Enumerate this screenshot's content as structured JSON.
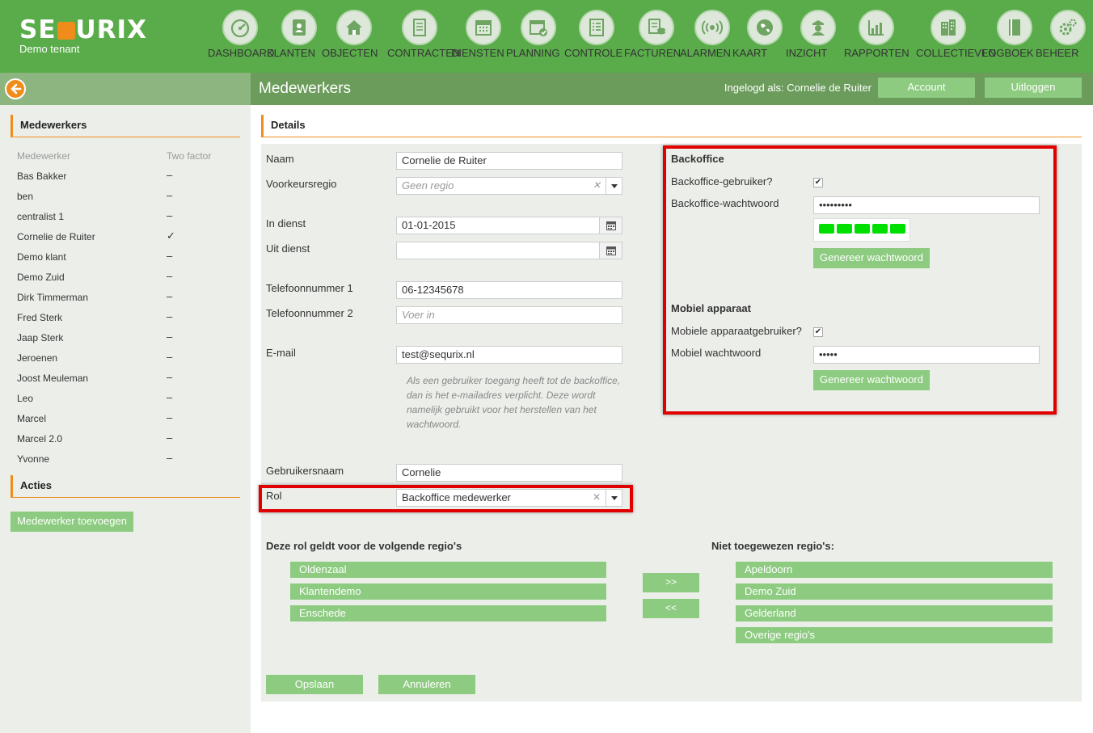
{
  "brand": {
    "name_prefix": "SE",
    "name_suffix": "URIX",
    "tenant": "Demo tenant"
  },
  "nav": [
    {
      "label": "DASHBOARD",
      "icon": "dashboard-gauge-icon"
    },
    {
      "label": "KLANTEN",
      "icon": "contacts-book-icon"
    },
    {
      "label": "OBJECTEN",
      "icon": "house-icon"
    },
    {
      "label": "CONTRACTEN",
      "icon": "document-icon"
    },
    {
      "label": "DIENSTEN",
      "icon": "calendar-icon"
    },
    {
      "label": "PLANNING",
      "icon": "planning-calendar-icon"
    },
    {
      "label": "CONTROLE",
      "icon": "checklist-icon"
    },
    {
      "label": "FACTUREN",
      "icon": "invoice-coins-icon"
    },
    {
      "label": "ALARMEN",
      "icon": "alarm-signal-icon"
    },
    {
      "label": "KAART",
      "icon": "globe-icon"
    },
    {
      "label": "INZICHT",
      "icon": "guard-icon"
    },
    {
      "label": "RAPPORTEN",
      "icon": "bar-chart-icon"
    },
    {
      "label": "COLLECTIEVEN",
      "icon": "buildings-icon"
    },
    {
      "label": "LOGBOEK",
      "icon": "book-icon"
    },
    {
      "label": "BEHEER",
      "icon": "gears-icon"
    }
  ],
  "header": {
    "title": "Medewerkers",
    "logged_in": "Ingelogd als: Cornelie de Ruiter",
    "account": "Account",
    "logout": "Uitloggen"
  },
  "sidebar": {
    "employees_title": "Medewerkers",
    "col_employee": "Medewerker",
    "col_two_factor": "Two factor",
    "employees": [
      {
        "name": "Bas Bakker",
        "two_factor": "–"
      },
      {
        "name": "ben",
        "two_factor": "–"
      },
      {
        "name": "centralist 1",
        "two_factor": "–"
      },
      {
        "name": "Cornelie de Ruiter",
        "two_factor": "✓"
      },
      {
        "name": "Demo klant",
        "two_factor": "–"
      },
      {
        "name": "Demo Zuid",
        "two_factor": "–"
      },
      {
        "name": "Dirk Timmerman",
        "two_factor": "–"
      },
      {
        "name": "Fred Sterk",
        "two_factor": "–"
      },
      {
        "name": "Jaap Sterk",
        "two_factor": "–"
      },
      {
        "name": "Jeroenen",
        "two_factor": "–"
      },
      {
        "name": "Joost Meuleman",
        "two_factor": "–"
      },
      {
        "name": "Leo",
        "two_factor": "–"
      },
      {
        "name": "Marcel",
        "two_factor": "–"
      },
      {
        "name": "Marcel 2.0",
        "two_factor": "–"
      },
      {
        "name": "Yvonne",
        "two_factor": "–"
      }
    ],
    "actions_title": "Acties",
    "add_employee": "Medewerker toevoegen"
  },
  "details": {
    "title": "Details",
    "name_label": "Naam",
    "name_value": "Cornelie de Ruiter",
    "region_label": "Voorkeursregio",
    "region_placeholder": "Geen regio",
    "in_service_label": "In dienst",
    "in_service_value": "01-01-2015",
    "out_service_label": "Uit dienst",
    "out_service_value": "",
    "phone1_label": "Telefoonnummer 1",
    "phone1_value": "06-12345678",
    "phone2_label": "Telefoonnummer 2",
    "phone2_placeholder": "Voer in",
    "email_label": "E-mail",
    "email_value": "test@sequrix.nl",
    "email_note": "Als een gebruiker toegang heeft tot de backoffice, dan is het e-mailadres verplicht. Deze wordt namelijk gebruikt voor het herstellen van het wachtwoord.",
    "username_label": "Gebruikersnaam",
    "username_value": "Cornelie",
    "role_label": "Rol",
    "role_value": "Backoffice medewerker"
  },
  "backoffice": {
    "title": "Backoffice",
    "user_label": "Backoffice-gebruiker?",
    "user_checked": true,
    "password_label": "Backoffice-wachtwoord",
    "password_value": "•••••••••",
    "password_strength": 5,
    "generate": "Genereer wachtwoord"
  },
  "mobile": {
    "title": "Mobiel apparaat",
    "user_label": "Mobiele apparaatgebruiker?",
    "user_checked": true,
    "password_label": "Mobiel wachtwoord",
    "password_value": "•••••",
    "generate": "Genereer wachtwoord"
  },
  "regions": {
    "assigned_title": "Deze rol geldt voor de volgende regio's",
    "assigned": [
      "Oldenzaal",
      "Klantendemo",
      "Enschede"
    ],
    "unassigned_title": "Niet toegewezen regio's:",
    "unassigned": [
      "Apeldoorn",
      "Demo Zuid",
      "Gelderland",
      "Overige regio's"
    ],
    "move_right": ">>",
    "move_left": "<<"
  },
  "form_actions": {
    "save": "Opslaan",
    "cancel": "Annuleren"
  },
  "colors": {
    "primary_green": "#5aac4a",
    "button_green": "#8ccb80",
    "accent_orange": "#f08c1a",
    "highlight_red": "#e00000",
    "panel_bg": "#ecefe9"
  }
}
